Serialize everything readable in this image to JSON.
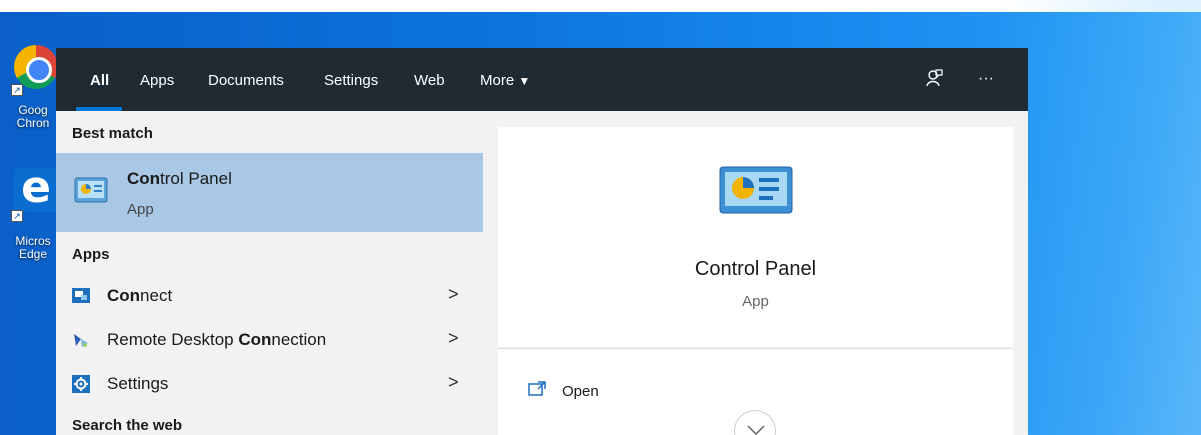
{
  "desktop": {
    "icons": [
      {
        "label_line1": "Goog",
        "label_line2": "Chron"
      },
      {
        "label_line1": "Micros",
        "label_line2": "Edge"
      }
    ]
  },
  "search": {
    "tabs": [
      {
        "label": "All",
        "active": true
      },
      {
        "label": "Apps"
      },
      {
        "label": "Documents"
      },
      {
        "label": "Settings"
      },
      {
        "label": "Web"
      },
      {
        "label": "More"
      }
    ],
    "more_arrow": "▼",
    "feedback_icon": "feedback-icon",
    "more_options": "···"
  },
  "results": {
    "best_match_header": "Best match",
    "best_match": {
      "name_bold": "Con",
      "name_rest": "trol Panel",
      "type": "App"
    },
    "apps_header": "Apps",
    "apps": [
      {
        "bold": "Con",
        "rest": "nect",
        "prefix": "",
        "icon": "connect-icon"
      },
      {
        "prefix": "Remote Desktop ",
        "bold": "Con",
        "rest": "nection",
        "icon": "remote-desktop-icon"
      },
      {
        "prefix": "",
        "bold": "",
        "rest": "Settings",
        "icon": "gear-icon"
      }
    ],
    "chevron": ">",
    "web_header": "Search the web"
  },
  "preview": {
    "title": "Control Panel",
    "type": "App",
    "actions": [
      {
        "label": "Open",
        "icon": "open-icon"
      }
    ]
  },
  "colors": {
    "accent": "#0078d7",
    "topbar": "#1f2a33",
    "selected": "#a8c8e6"
  }
}
